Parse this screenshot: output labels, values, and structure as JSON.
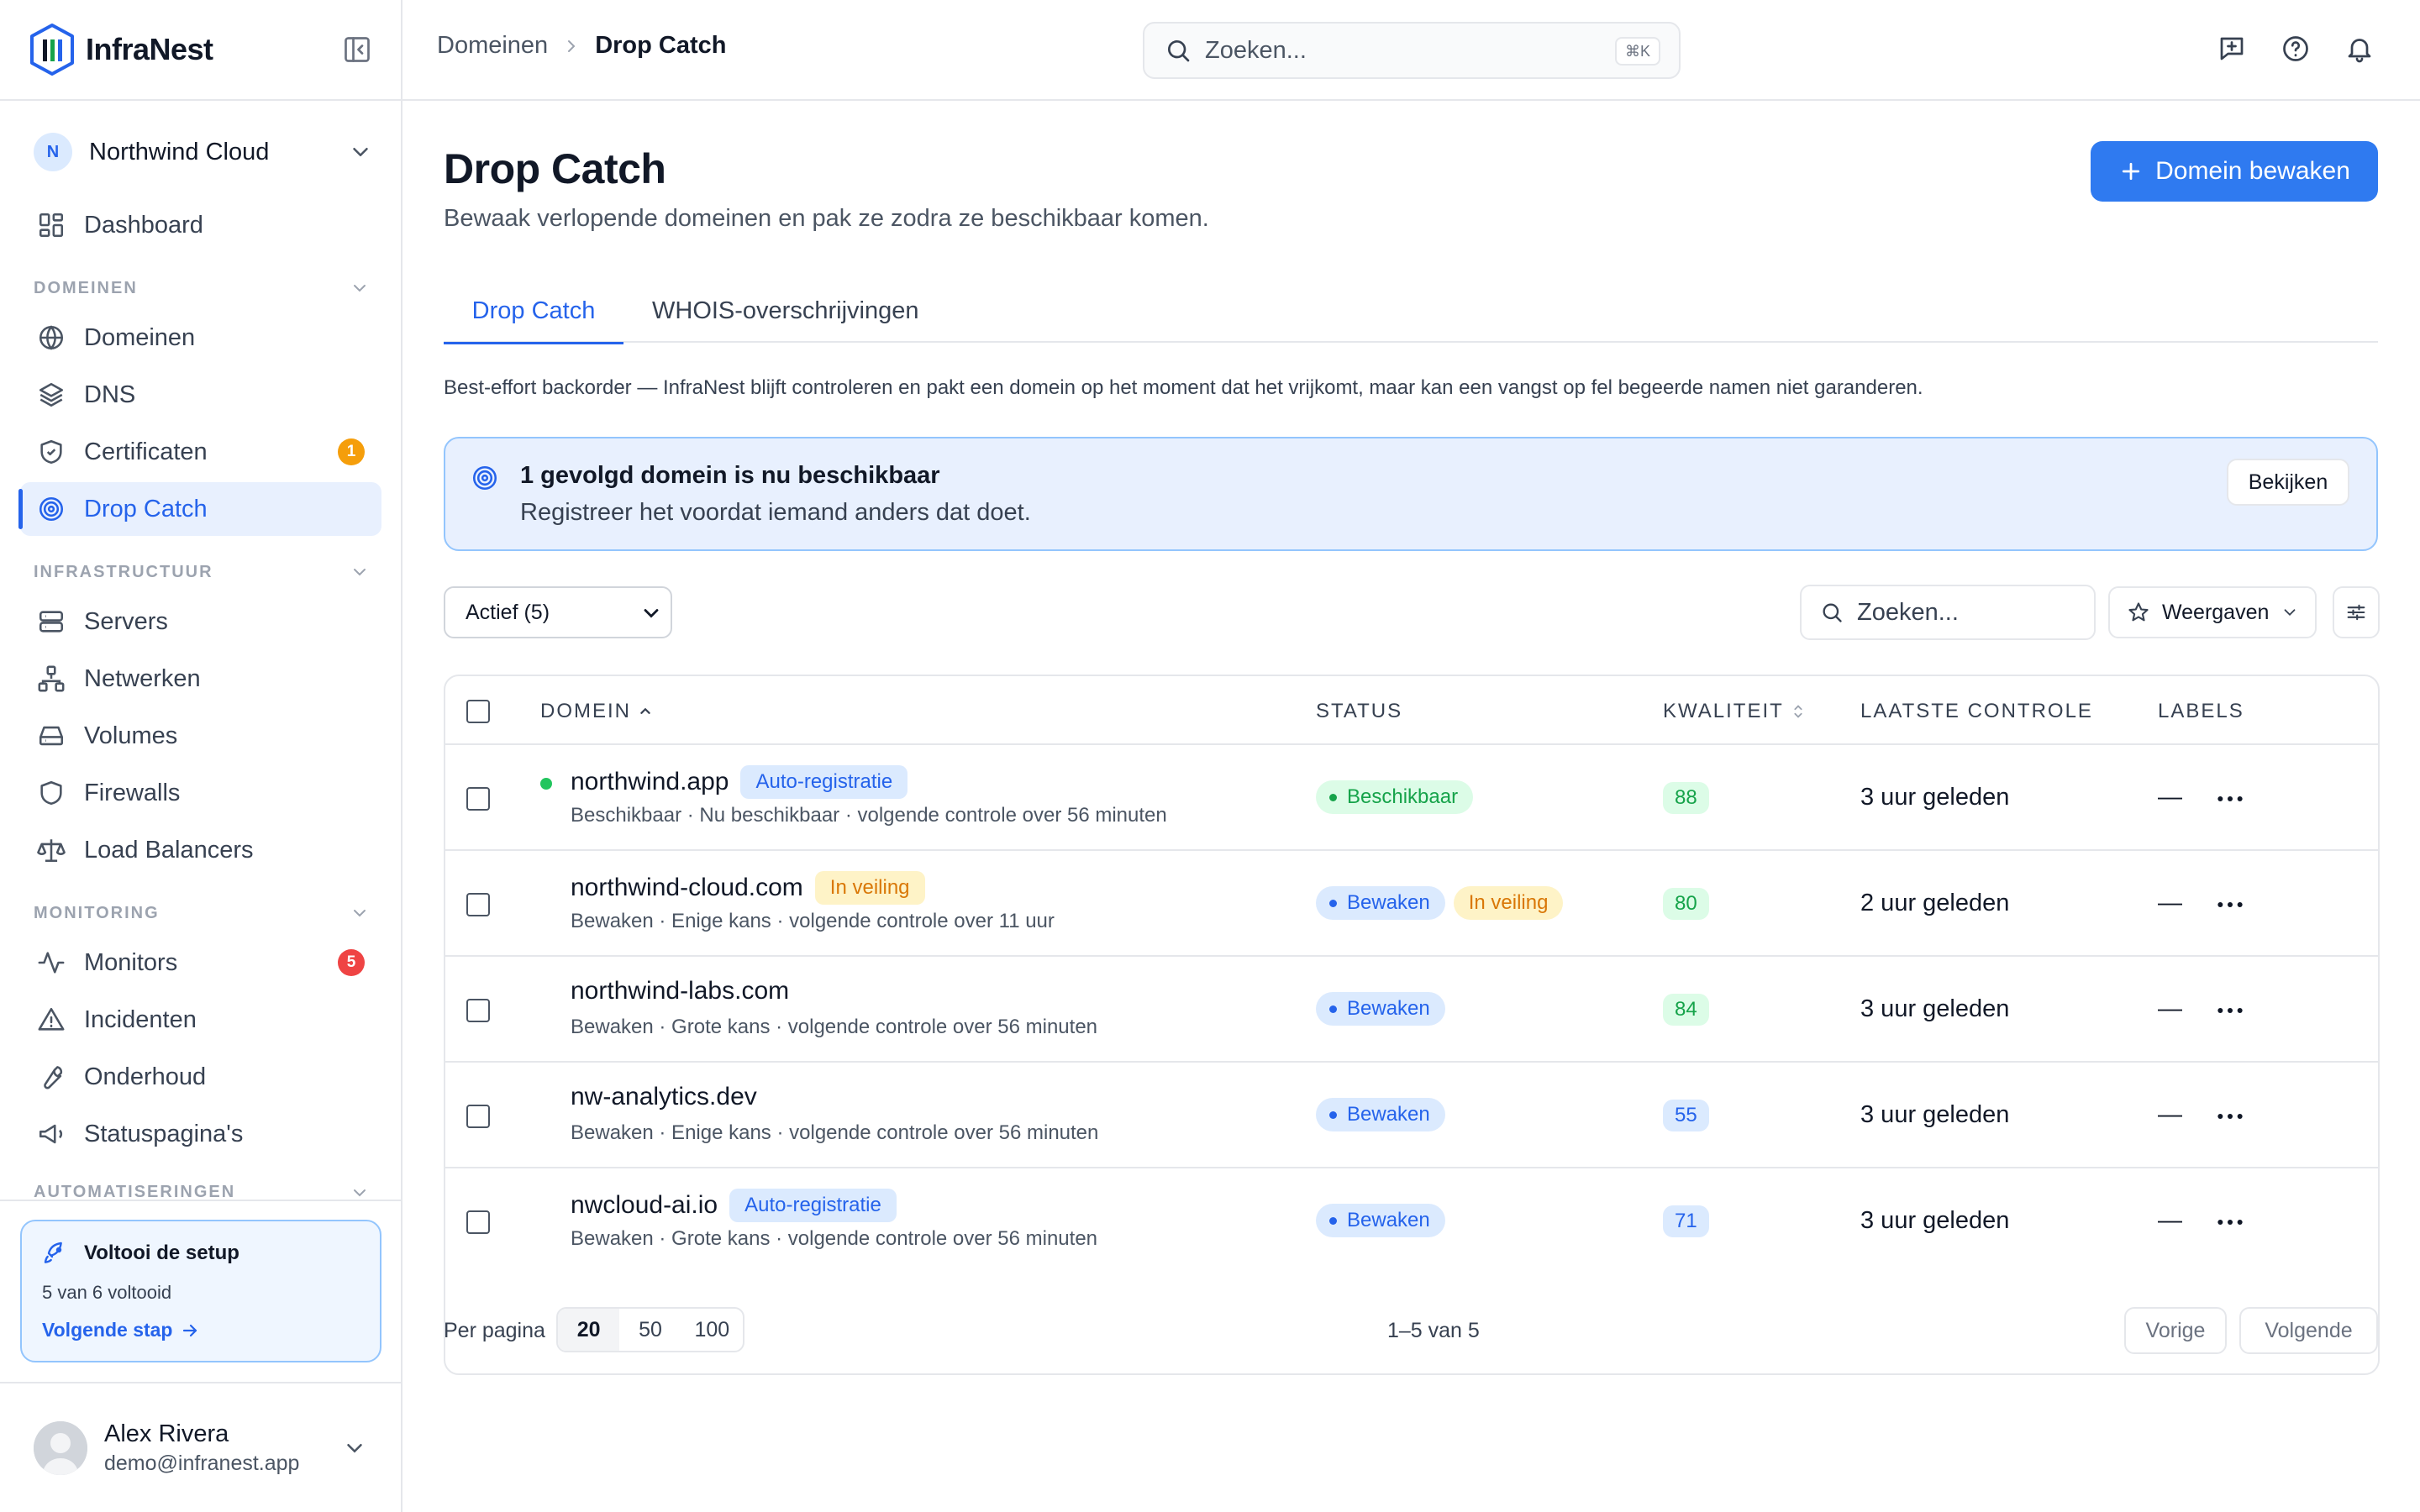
{
  "app": {
    "brand": "InfraNest"
  },
  "org": {
    "initial": "N",
    "name": "Northwind Cloud"
  },
  "sidebar": {
    "dashboard": "Dashboard",
    "sections": {
      "domeinen": "DOMEINEN",
      "infrastructuur": "INFRASTRUCTUUR",
      "monitoring": "MONITORING",
      "automatiseringen": "AUTOMATISERINGEN"
    },
    "items": {
      "domeinen": "Domeinen",
      "dns": "DNS",
      "certificaten": "Certificaten",
      "certificaten_badge": "1",
      "drop_catch": "Drop Catch",
      "servers": "Servers",
      "netwerken": "Netwerken",
      "volumes": "Volumes",
      "firewalls": "Firewalls",
      "load_balancers": "Load Balancers",
      "monitors": "Monitors",
      "monitors_badge": "5",
      "incidenten": "Incidenten",
      "onderhoud": "Onderhoud",
      "statuspaginas": "Statuspagina's"
    },
    "setup": {
      "title": "Voltooi de setup",
      "progress": "5 van 6 voltooid",
      "next": "Volgende stap"
    },
    "user": {
      "name": "Alex Rivera",
      "email": "demo@infranest.app"
    }
  },
  "topbar": {
    "breadcrumb": [
      "Domeinen",
      "Drop Catch"
    ],
    "search_placeholder": "Zoeken...",
    "search_shortcut": "⌘K"
  },
  "page": {
    "title": "Drop Catch",
    "subtitle": "Bewaak verlopende domeinen en pak ze zodra ze beschikbaar komen.",
    "primary_action": "Domein bewaken",
    "tabs": [
      "Drop Catch",
      "WHOIS-overschrijvingen"
    ],
    "notice": "Best-effort backorder — InfraNest blijft controleren en pakt een domein op het moment dat het vrijkomt, maar kan een vangst op fel begeerde namen niet garanderen.",
    "alert": {
      "title": "1 gevolgd domein is nu beschikbaar",
      "body": "Registreer het voordat iemand anders dat doet.",
      "action": "Bekijken"
    },
    "filter": {
      "selected": "Actief (5)"
    },
    "table_search_placeholder": "Zoeken...",
    "views_label": "Weergaven"
  },
  "table": {
    "headers": {
      "domain": "DOMEIN",
      "status": "STATUS",
      "quality": "KWALITEIT",
      "last_check": "LAATSTE CONTROLE",
      "labels": "LABELS"
    },
    "rows": [
      {
        "domain": "northwind.app",
        "tag": "Auto-registratie",
        "meta": "Beschikbaar · Nu beschikbaar · volgende controle over 56 minuten",
        "status": "Beschikbaar",
        "quality": "88",
        "last_check": "3 uur geleden",
        "labels": "—"
      },
      {
        "domain": "northwind-cloud.com",
        "tag": "In veiling",
        "meta": "Bewaken · Enige kans · volgende controle over 11 uur",
        "status": "Bewaken",
        "status2": "In veiling",
        "quality": "80",
        "last_check": "2 uur geleden",
        "labels": "—"
      },
      {
        "domain": "northwind-labs.com",
        "meta": "Bewaken · Grote kans · volgende controle over 56 minuten",
        "status": "Bewaken",
        "quality": "84",
        "last_check": "3 uur geleden",
        "labels": "—"
      },
      {
        "domain": "nw-analytics.dev",
        "meta": "Bewaken · Enige kans · volgende controle over 56 minuten",
        "status": "Bewaken",
        "quality": "55",
        "last_check": "3 uur geleden",
        "labels": "—"
      },
      {
        "domain": "nwcloud-ai.io",
        "tag": "Auto-registratie",
        "meta": "Bewaken · Grote kans · volgende controle over 56 minuten",
        "status": "Bewaken",
        "quality": "71",
        "last_check": "3 uur geleden",
        "labels": "—"
      }
    ]
  },
  "pagination": {
    "per_page_label": "Per pagina",
    "options": [
      "20",
      "50",
      "100"
    ],
    "range": "1–5 van 5",
    "prev": "Vorige",
    "next": "Volgende"
  },
  "colors": {
    "primary": "#2f7af0",
    "success": "#16a34a",
    "warning": "#d97706",
    "danger": "#ef4444",
    "badge_amber": "#f59e0b"
  }
}
